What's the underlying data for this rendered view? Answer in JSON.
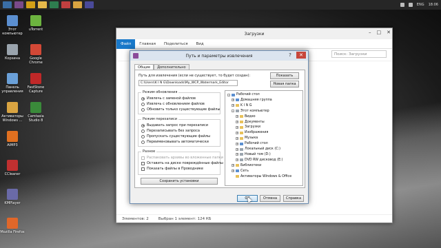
{
  "taskbar": {
    "buttons": [
      {
        "icon": "start-icon",
        "color": "#3a6ea5"
      },
      {
        "icon": "winrar-icon",
        "color": "#7a4a8a"
      },
      {
        "icon": "chrome-icon",
        "color": "#d4a017"
      },
      {
        "icon": "explorer-icon",
        "color": "#e6b84a"
      },
      {
        "icon": "store-icon",
        "color": "#2e7d4f"
      },
      {
        "icon": "media-icon",
        "color": "#c04040"
      },
      {
        "icon": "folder-icon",
        "color": "#d9a441"
      },
      {
        "icon": "app-icon",
        "color": "#4a4a9a"
      }
    ],
    "lang": "ENG",
    "time": "18:06"
  },
  "desktop_icons": [
    {
      "label": "Этот компьютер",
      "icon": "computer-icon",
      "color": "#5b8fd0"
    },
    {
      "label": "Корзина",
      "icon": "recycle-bin-icon",
      "color": "#9aa4ad"
    },
    {
      "label": "Панель управления",
      "icon": "control-panel-icon",
      "color": "#6aa0d8"
    },
    {
      "label": "Активаторы Windows ...",
      "icon": "activator-icon",
      "color": "#d9a441"
    },
    {
      "label": "AIMP3",
      "icon": "aimp-icon",
      "color": "#e07020"
    },
    {
      "label": "CCleaner",
      "icon": "ccleaner-icon",
      "color": "#c03030"
    },
    {
      "label": "KMPlayer",
      "icon": "kmplayer-icon",
      "color": "#6a6aa8"
    },
    {
      "label": "Mozilla Firefox",
      "icon": "firefox-icon",
      "color": "#e0672a"
    },
    {
      "label": "uTorrent",
      "icon": "utorrent-icon",
      "color": "#6cb33f"
    },
    {
      "label": "Google Chrome",
      "icon": "chrome-icon",
      "color": "#d34836"
    },
    {
      "label": "FastStone Capture",
      "icon": "faststone-icon",
      "color": "#c02828"
    },
    {
      "label": "Camtasia Studio 8",
      "icon": "camtasia-icon",
      "color": "#3a8a3a"
    }
  ],
  "explorer": {
    "title": "Загрузки",
    "tabs": [
      "Файл",
      "Главная",
      "Поделиться",
      "Вид"
    ],
    "search_placeholder": "Поиск: Загрузки",
    "status_items": "Элементов: 2",
    "status_selected": "Выбран 1 элемент: 124 КБ"
  },
  "dialog": {
    "title": "Путь и параметры извлечения",
    "tabs": [
      "Общие",
      "Дополнительно"
    ],
    "path_label": "Путь для извлечения (если не существует, то будет создан):",
    "path_value": "C:\\Users\\K I N G\\Downloads\\My_WCP_Watermark_Editor",
    "show_button": "Показать",
    "new_folder_button": "Новая папка",
    "update_mode": {
      "title": "Режим обновления",
      "options": [
        {
          "label": "Извлечь с заменой файлов",
          "selected": true
        },
        {
          "label": "Извлечь с обновлением файлов",
          "selected": false
        },
        {
          "label": "Обновить только существующие файлы",
          "selected": false
        }
      ]
    },
    "overwrite_mode": {
      "title": "Режим перезаписи",
      "options": [
        {
          "label": "Выдавать запрос при перезаписи",
          "selected": true
        },
        {
          "label": "Перезаписывать без запроса",
          "selected": false
        },
        {
          "label": "Пропускать существующие файлы",
          "selected": false
        },
        {
          "label": "Переименовывать автоматически",
          "selected": false
        }
      ]
    },
    "misc": {
      "title": "Разное",
      "options": [
        {
          "label": "Распаковать архивы во вложенные папки",
          "checked": false,
          "disabled": true
        },
        {
          "label": "Оставить на диске повреждённые файлы",
          "checked": false,
          "disabled": false
        },
        {
          "label": "Показать файлы в Проводнике",
          "checked": false,
          "disabled": false
        }
      ]
    },
    "save_settings_button": "Сохранить установки",
    "tree": [
      {
        "label": "Рабочий стол",
        "level": 0,
        "exp": "-",
        "folder": "blue"
      },
      {
        "label": "Домашняя группа",
        "level": 1,
        "exp": "+",
        "folder": "blue"
      },
      {
        "label": "K I N G",
        "level": 1,
        "exp": "+",
        "folder": "yellow"
      },
      {
        "label": "Этот компьютер",
        "level": 1,
        "exp": "-",
        "folder": "gray"
      },
      {
        "label": "Видео",
        "level": 2,
        "exp": "+",
        "folder": "yellow"
      },
      {
        "label": "Документы",
        "level": 2,
        "exp": "+",
        "folder": "yellow"
      },
      {
        "label": "Загрузки",
        "level": 2,
        "exp": "+",
        "folder": "yellow"
      },
      {
        "label": "Изображения",
        "level": 2,
        "exp": "+",
        "folder": "yellow"
      },
      {
        "label": "Музыка",
        "level": 2,
        "exp": "+",
        "folder": "yellow"
      },
      {
        "label": "Рабочий стол",
        "level": 2,
        "exp": "+",
        "folder": "blue"
      },
      {
        "label": "Локальный диск (C:)",
        "level": 2,
        "exp": "+",
        "folder": "gray"
      },
      {
        "label": "Новый том (D:)",
        "level": 2,
        "exp": "+",
        "folder": "gray"
      },
      {
        "label": "DVD RW дисковод (E:)",
        "level": 2,
        "exp": "+",
        "folder": "gray"
      },
      {
        "label": "Библиотеки",
        "level": 1,
        "exp": "+",
        "folder": "yellow"
      },
      {
        "label": "Сеть",
        "level": 1,
        "exp": "+",
        "folder": "blue"
      },
      {
        "label": "Активаторы Windows & Office",
        "level": 1,
        "exp": "",
        "folder": "yellow"
      }
    ],
    "ok_button": "OK",
    "cancel_button": "Отмена",
    "help_button": "Справка"
  }
}
